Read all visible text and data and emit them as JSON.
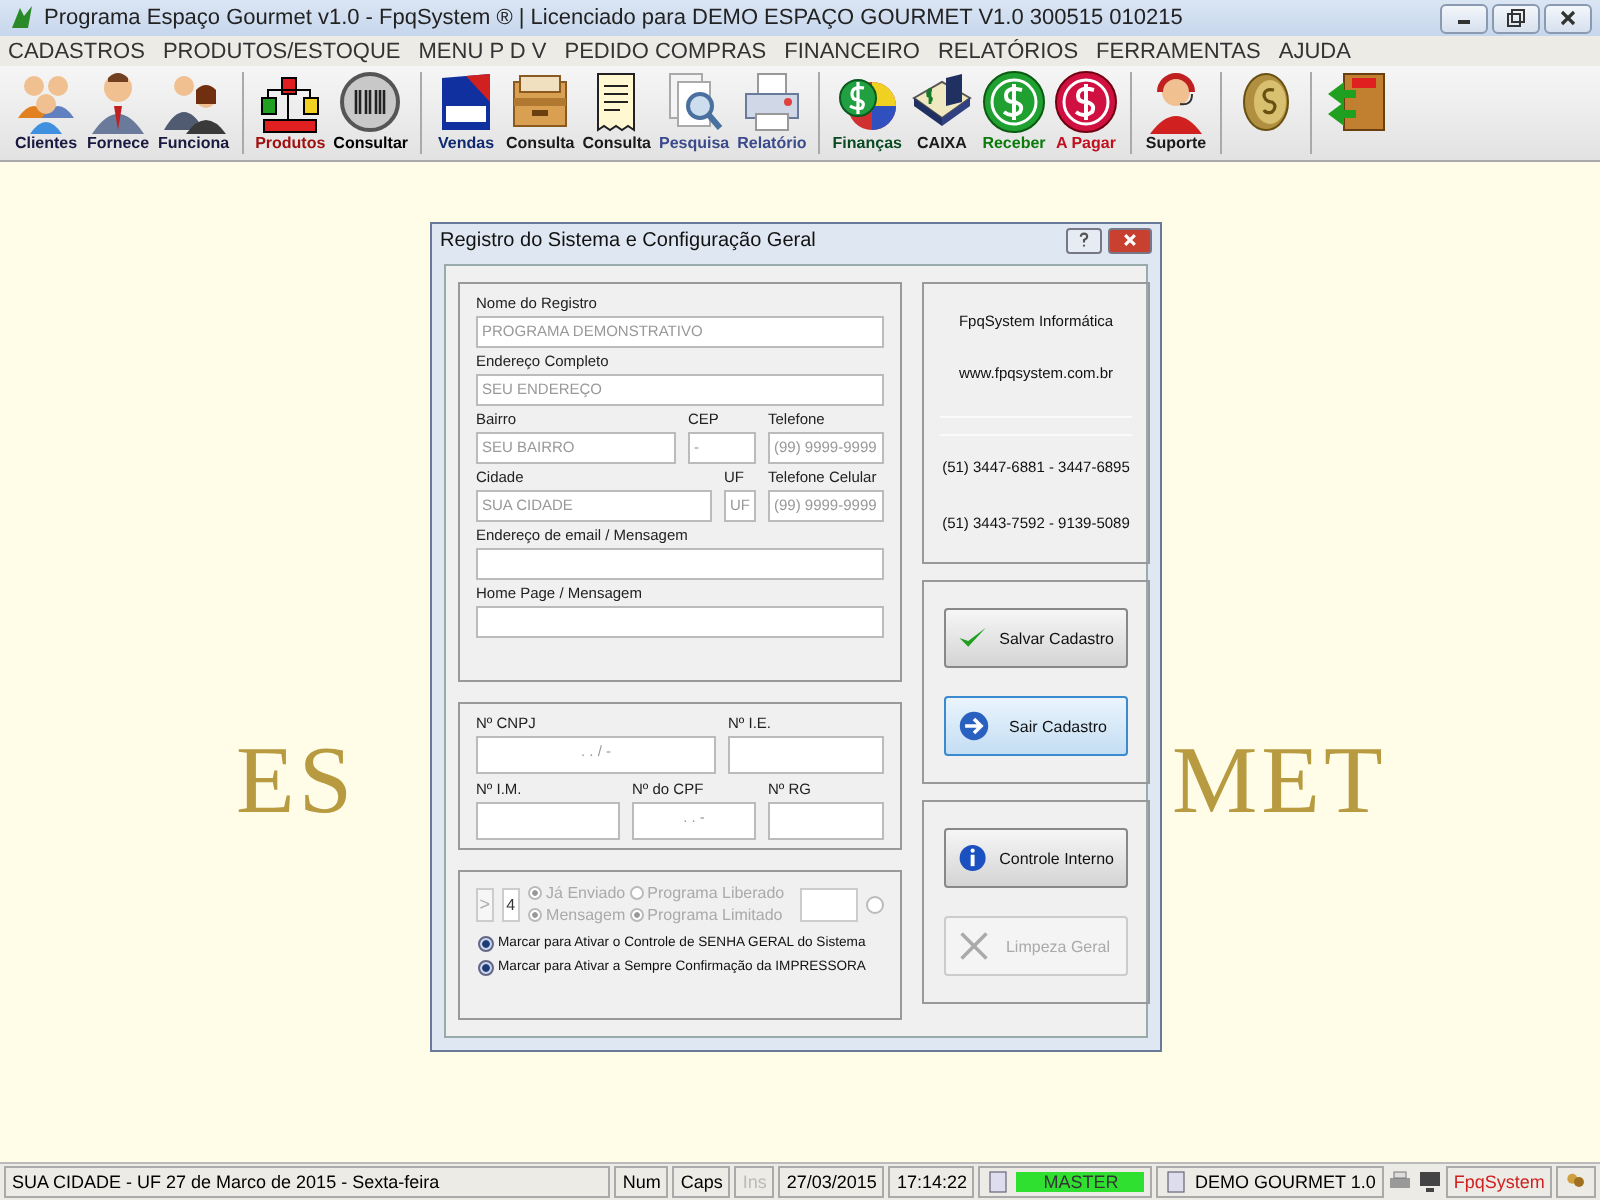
{
  "window": {
    "title": "Programa Espaço Gourmet v1.0 - FpqSystem ® | Licenciado para  DEMO ESPAÇO GOURMET V1.0 300515 010215"
  },
  "menu": [
    "CADASTROS",
    "PRODUTOS/ESTOQUE",
    "MENU P D V",
    "PEDIDO COMPRAS",
    "FINANCEIRO",
    "RELATÓRIOS",
    "FERRAMENTAS",
    "AJUDA"
  ],
  "toolbar": [
    {
      "label": "Clientes",
      "kind": "people",
      "color": "#1a1a40",
      "separator_after": false
    },
    {
      "label": "Fornece",
      "kind": "person",
      "color": "#1a1a40",
      "separator_after": false
    },
    {
      "label": "Funciona",
      "kind": "couple",
      "color": "#1a1a40",
      "separator_after": true
    },
    {
      "label": "Produtos",
      "kind": "bars",
      "color": "#a01010",
      "separator_after": false
    },
    {
      "label": "Consultar",
      "kind": "barcode",
      "color": "#000000",
      "separator_after": true
    },
    {
      "label": "Vendas",
      "kind": "pdv",
      "color": "#102a70",
      "separator_after": false
    },
    {
      "label": "Consulta",
      "kind": "box",
      "color": "#1a1a1a",
      "separator_after": false
    },
    {
      "label": "Consulta",
      "kind": "receipt",
      "color": "#1a1a1a",
      "separator_after": false
    },
    {
      "label": "Pesquisa",
      "kind": "search",
      "color": "#3a4a8a",
      "separator_after": false
    },
    {
      "label": "Relatório",
      "kind": "printer",
      "color": "#3a4a8a",
      "separator_after": true
    },
    {
      "label": "Finanças",
      "kind": "money",
      "color": "#0a4a20",
      "separator_after": false
    },
    {
      "label": "CAIXA",
      "kind": "book",
      "color": "#1a1a1a",
      "separator_after": false
    },
    {
      "label": "Receber",
      "kind": "coin-green",
      "color": "#0a7a0a",
      "separator_after": false
    },
    {
      "label": "A Pagar",
      "kind": "coin-red",
      "color": "#c01020",
      "separator_after": true
    },
    {
      "label": "Suporte",
      "kind": "headset",
      "color": "#1a1a1a",
      "separator_after": true
    },
    {
      "kind": "coin-gold",
      "separator_after": true
    },
    {
      "kind": "exit",
      "separator_after": false
    }
  ],
  "background_logo": [
    "ES",
    "MET"
  ],
  "dialog": {
    "title": "Registro do Sistema e Configuração Geral",
    "address_rows": [
      [
        {
          "label": "Nome do Registro",
          "value": "PROGRAMA DEMONSTRATIVO"
        }
      ],
      [
        {
          "label": "Endereço Completo",
          "value": "SEU ENDEREÇO"
        }
      ],
      [
        {
          "label": "Bairro",
          "value": "SEU BAIRRO"
        },
        {
          "label": "CEP",
          "value": "-"
        },
        {
          "label": "Telefone",
          "value": "(99) 9999-9999"
        }
      ],
      [
        {
          "label": "Cidade",
          "value": "SUA CIDADE"
        },
        {
          "label": "UF",
          "value": "UF"
        },
        {
          "label": "Telefone Celular",
          "value": "(99) 9999-9999"
        }
      ],
      [
        {
          "label": "Endereço de email / Mensagem"
        }
      ],
      [
        {
          "label": "Home Page / Mensagem"
        }
      ]
    ],
    "id_rows": [
      [
        {
          "label": "Nº CNPJ",
          "value": ".   .   /   -"
        },
        {
          "label": "Nº I.E."
        }
      ],
      [
        {
          "label": "Nº I.M."
        },
        {
          "label": "Nº do CPF",
          "value": ".   .   -"
        },
        {
          "label": "Nº RG"
        }
      ]
    ],
    "options": {
      "spin": ">",
      "count": "4",
      "radios": [
        {
          "label": "Já Enviado",
          "selected": true
        },
        {
          "label": "Programa Liberado",
          "selected": false
        },
        {
          "label": "Mensagem",
          "selected": true
        },
        {
          "label": "Programa Limitado",
          "selected": true
        }
      ],
      "extra_radio": {
        "selected": false
      },
      "checks": [
        {
          "label": "Marcar para Ativar o Controle de SENHA GERAL do Sistema",
          "checked": true
        },
        {
          "label": "Marcar para Ativar a Sempre Confirmação da IMPRESSORA",
          "checked": true
        }
      ]
    },
    "info": [
      "FpqSystem Informática",
      "www.fpqsystem.com.br",
      "(51) 3447-6881 - 3447-6895",
      "(51) 3443-7592 - 9139-5089"
    ],
    "buttons": [
      {
        "label": "Salvar Cadastro",
        "kind": "check",
        "focused": false,
        "disabled": false
      },
      {
        "label": "Sair Cadastro",
        "kind": "arrow",
        "focused": true,
        "disabled": false
      },
      {
        "label": "Controle Interno",
        "kind": "info",
        "focused": false,
        "disabled": false
      },
      {
        "label": "Limpeza Geral",
        "kind": "tools",
        "focused": false,
        "disabled": true
      }
    ]
  },
  "status_bar": [
    {
      "text": "SUA CIDADE - UF 27 de Marco de 2015 - Sexta-feira",
      "kind": "main"
    },
    {
      "text": "Num",
      "kind": "plain"
    },
    {
      "text": "Caps",
      "kind": "plain"
    },
    {
      "text": "Ins",
      "kind": "off"
    },
    {
      "text": "27/03/2015",
      "kind": "plain"
    },
    {
      "text": "17:14:22",
      "kind": "plain"
    },
    {
      "text": "MASTER",
      "kind": "user"
    },
    {
      "text": "DEMO GOURMET 1.0",
      "kind": "company"
    },
    {
      "kind": "icons"
    },
    {
      "text": "FpqSystem",
      "kind": "brand"
    },
    {
      "kind": "key"
    }
  ]
}
